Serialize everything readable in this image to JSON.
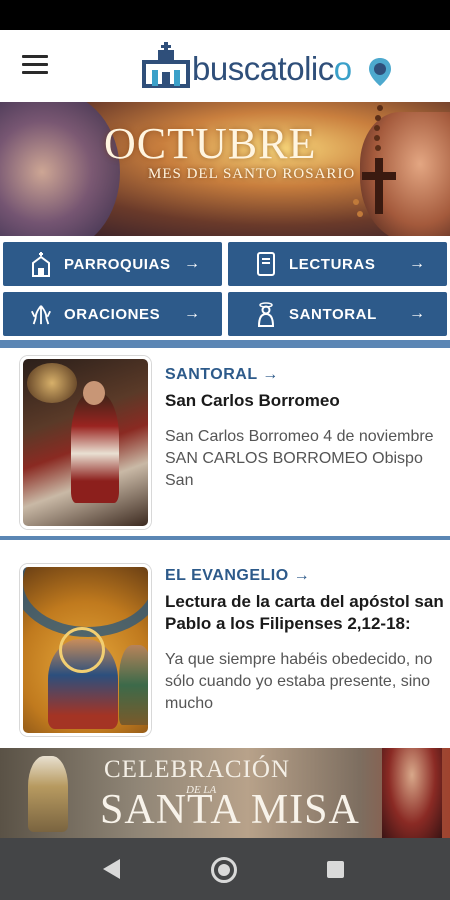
{
  "app": {
    "brand": {
      "text_main": "buscatolic",
      "text_end": "o"
    },
    "menu_icon": "hamburger-menu-icon"
  },
  "hero": {
    "title": "OCTUBRE",
    "subtitle": "MES DEL SANTO ROSARIO"
  },
  "nav": {
    "items": [
      {
        "label": "PARROQUIAS",
        "icon": "church-icon",
        "arrow": "→"
      },
      {
        "label": "LECTURAS",
        "icon": "book-icon",
        "arrow": "→"
      },
      {
        "label": "ORACIONES",
        "icon": "praying-hands-icon",
        "arrow": "→"
      },
      {
        "label": "SANTORAL",
        "icon": "saint-icon",
        "arrow": "→"
      }
    ]
  },
  "cards": [
    {
      "kicker": "SANTORAL",
      "arrow": "→",
      "title": "San Carlos Borromeo",
      "text": "San Carlos Borromeo 4 de noviembre SAN CARLOS BORROMEO Obispo San"
    },
    {
      "kicker": "EL EVANGELIO",
      "arrow": "→",
      "title": "Lectura de la carta del apóstol san Pablo a los Filipenses 2,12-18:",
      "text": "Ya que siempre habéis obedecido, no sólo cuando yo estaba presente, sino mucho"
    }
  ],
  "banner": {
    "line1": "CELEBRACIÓN",
    "line2": "DE LA",
    "line3": "SANTA MISA"
  },
  "colors": {
    "brand_blue": "#2d5a8a",
    "accent_cyan": "#3aa0c9",
    "stripe": "#5b86b4"
  }
}
